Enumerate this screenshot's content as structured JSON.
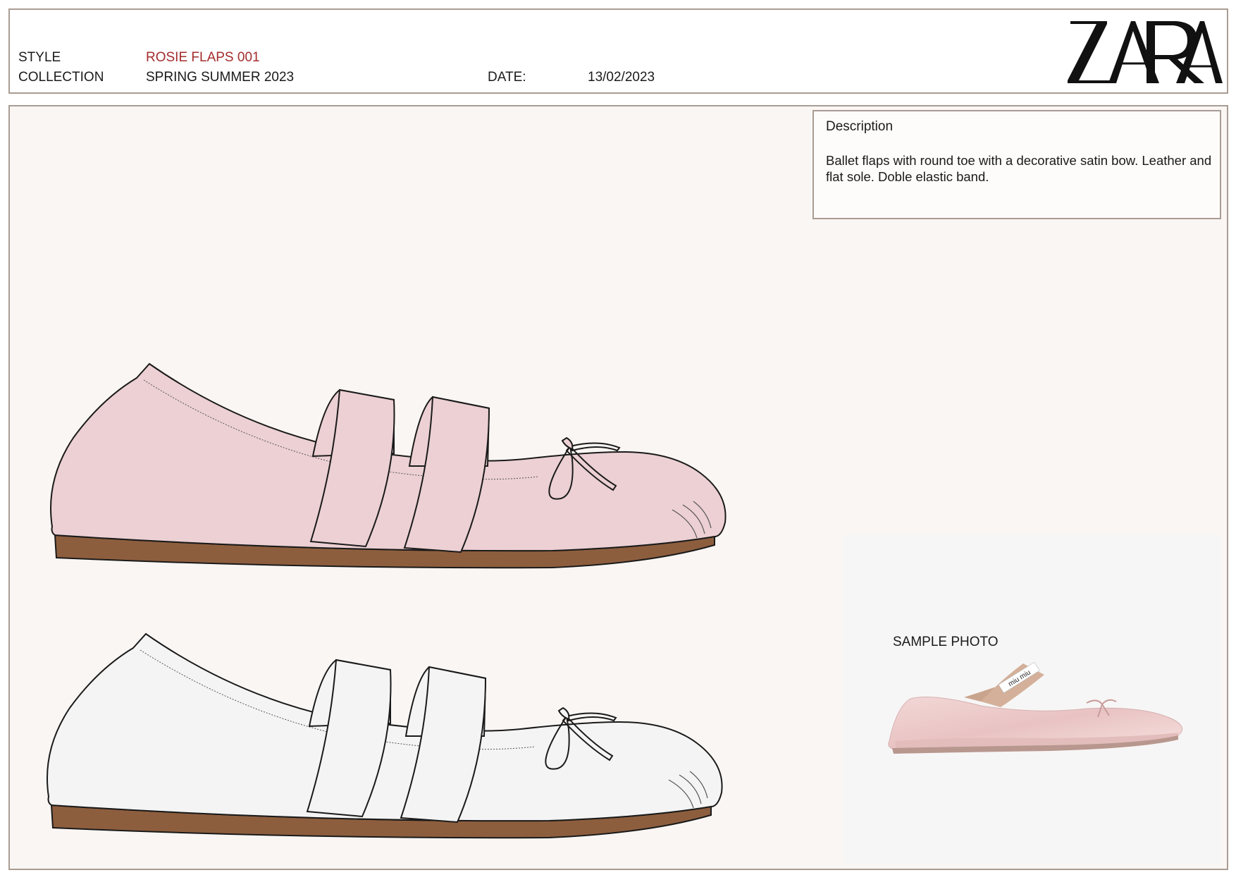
{
  "header": {
    "style_label": "STYLE",
    "style_value": "ROSIE FLAPS 001",
    "collection_label": "COLLECTION",
    "collection_value": "SPRING SUMMER 2023",
    "date_label": "DATE:",
    "date_value": "13/02/2023",
    "brand_logo": "ZARA"
  },
  "description": {
    "title": "Description",
    "body": "Ballet flaps with round toe with a decorative satin bow. Leather and flat sole. Doble elastic band."
  },
  "sample": {
    "label": "SAMPLE PHOTO",
    "strap_text": "miu miu"
  },
  "colors": {
    "border": "#a99c93",
    "style_value": "#a32c2c",
    "shoe_pink": "#ecd0d3",
    "shoe_white": "#f4f4f4",
    "sole": "#8d5e3e",
    "main_bg": "#faf6f3"
  }
}
